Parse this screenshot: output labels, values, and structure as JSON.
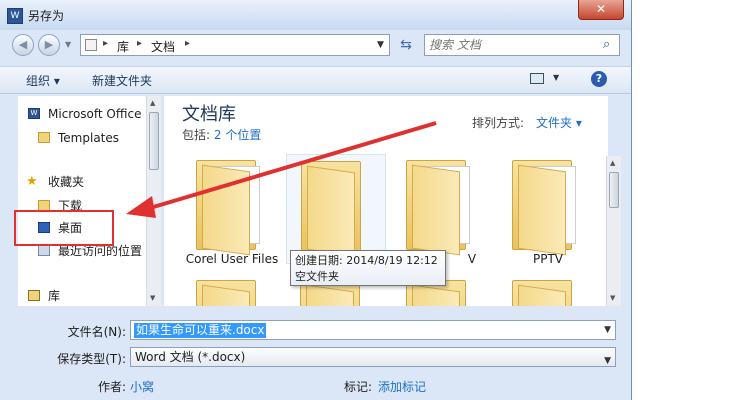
{
  "window": {
    "title": "另存为",
    "app_icon": "W",
    "close_glyph": "✕"
  },
  "nav": {
    "back_glyph": "◀",
    "forward_glyph": "▶",
    "breadcrumb": [
      "库",
      "文档"
    ],
    "breadcrumb_sep": "▸",
    "search_placeholder": "搜索 文档"
  },
  "toolbar": {
    "organize": "组织 ▾",
    "new_folder": "新建文件夹"
  },
  "sidebar": {
    "items": [
      {
        "label": "Microsoft Office",
        "icon": "word-icon"
      },
      {
        "label": "Templates",
        "icon": "folder-icon"
      },
      {
        "label": "收藏夹",
        "icon": "star-icon"
      },
      {
        "label": "下载",
        "icon": "download-folder-icon"
      },
      {
        "label": "桌面",
        "icon": "desktop-icon"
      },
      {
        "label": "最近访问的位置",
        "icon": "recent-places-icon"
      },
      {
        "label": "库",
        "icon": "library-icon"
      }
    ]
  },
  "library": {
    "title": "文档库",
    "includes_label": "包括:",
    "includes_link": "2 个位置",
    "arrange_label": "排列方式:",
    "arrange_value": "文件夹 ▾"
  },
  "folders": [
    {
      "name": "Corel User Files"
    },
    {
      "name": ""
    },
    {
      "name": "V"
    },
    {
      "name": "PPTV"
    }
  ],
  "tooltip": {
    "line1": "创建日期: 2014/8/19 12:12",
    "line2": "空文件夹"
  },
  "form": {
    "filename_label": "文件名(N):",
    "filename_value": "如果生命可以重来.docx",
    "type_label": "保存类型(T):",
    "type_value": "Word 文档 (*.docx)",
    "author_label": "作者:",
    "author_value": "小窝",
    "tags_label": "标记:",
    "tags_value": "添加标记"
  },
  "colors": {
    "accent": "#1e6fc9",
    "annotation": "#e03030",
    "selection": "#3399ff"
  }
}
